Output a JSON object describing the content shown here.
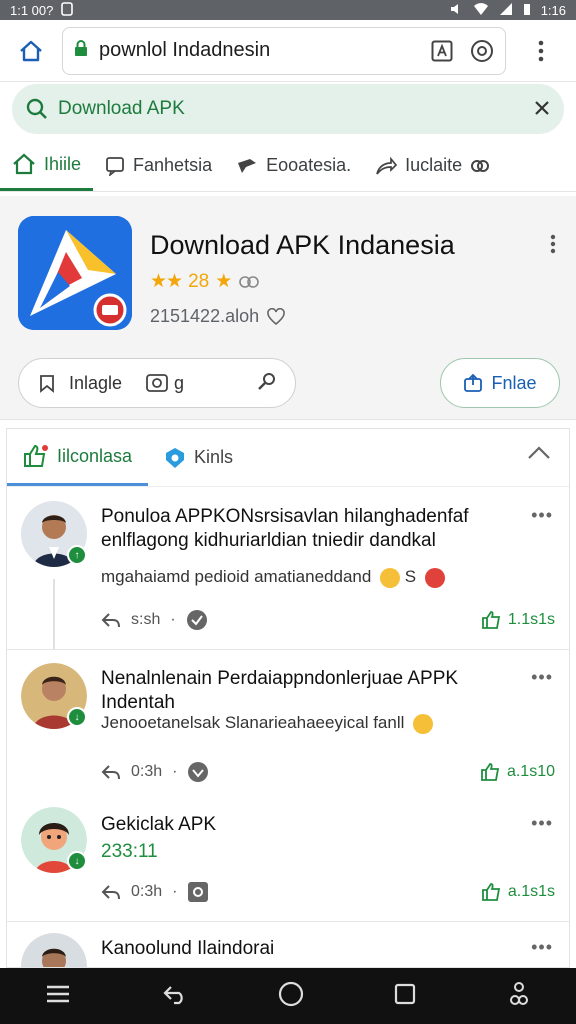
{
  "status": {
    "time_left": "1:1 00?",
    "time_right": "1:16"
  },
  "browser": {
    "url": "pownlol Indadnesin"
  },
  "search": {
    "query": "Download APK"
  },
  "tabs": [
    {
      "label": "Ihiile"
    },
    {
      "label": "Fanhetsia"
    },
    {
      "label": "Eooatesia."
    },
    {
      "label": "Iuclaite"
    }
  ],
  "app": {
    "title": "Download APK Indanesia",
    "rating_text": "28",
    "meta": "2151422.aloh",
    "btn_left_label": "Inlagle",
    "btn_left_aux": "g",
    "btn_right_label": "Fnlae"
  },
  "comments_section": {
    "tab_active": "Iilconlasa",
    "tab_other": "Kinls",
    "items": [
      {
        "title": "Ponuloa APPKONsrsisavlan hilanghadenfaf enlflagong kidhuriarldian tniedir dandkal",
        "body": "mgahaiamd pedioid amatianeddand",
        "body_tail": "S",
        "time": "s:sh",
        "likes": "1.1s1s"
      },
      {
        "title": "Nenalnlenain Perdaiappndonlerjuae APPK Indentah",
        "body": "Jenooetanelsak Slanarieahaeeyical fanll",
        "time": "0:3h",
        "likes": "a.1s10"
      },
      {
        "title": "Gekiclak APK",
        "body": "233:11",
        "time": "0:3h",
        "likes": "a.1s1s"
      },
      {
        "title": "Kanoolund Ilaindorai"
      }
    ]
  },
  "colors": {
    "accent_green": "#1e7b3e",
    "app_blue": "#1f6fe0",
    "star": "#f2a60a"
  }
}
